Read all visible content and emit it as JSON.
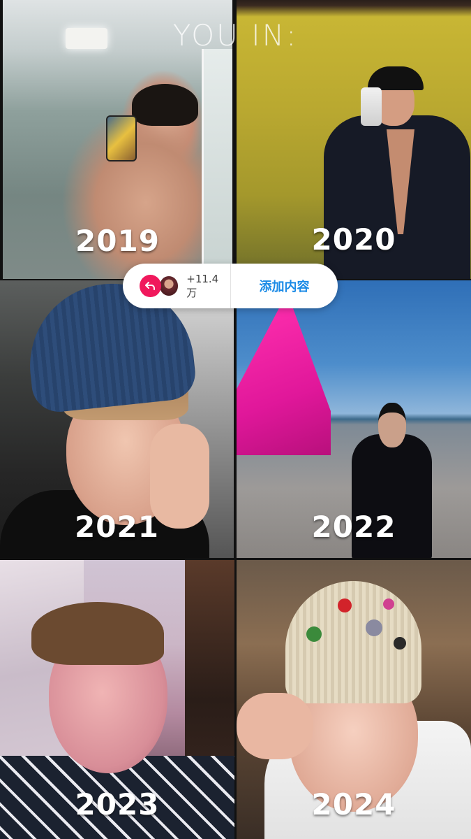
{
  "overlay": {
    "title": "YOU IN:"
  },
  "tiles": [
    {
      "year": "2019"
    },
    {
      "year": "2020"
    },
    {
      "year": "2021"
    },
    {
      "year": "2022"
    },
    {
      "year": "2023"
    },
    {
      "year": "2024"
    }
  ],
  "action_bar": {
    "reply_icon": "reply-arrow-icon",
    "avatar": "user-avatar",
    "count": "+11.4 万",
    "add_label": "添加内容",
    "colors": {
      "reply_icon_bg": "#f0185c",
      "add_label": "#1a8ae6",
      "background": "#ffffff"
    }
  }
}
